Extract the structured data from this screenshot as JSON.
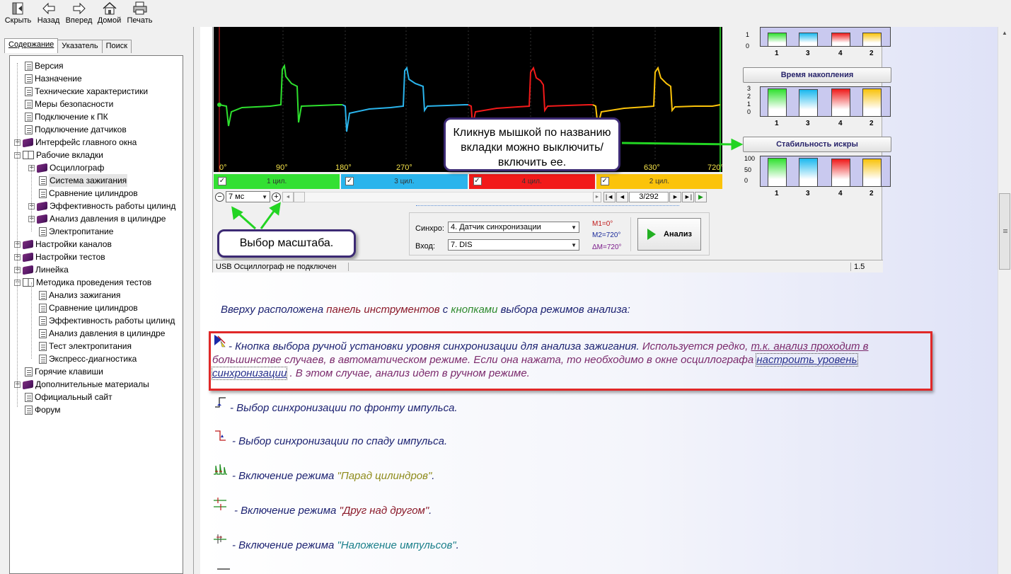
{
  "toolbar": {
    "buttons": [
      {
        "label": "Скрыть",
        "icon": "hide-icon"
      },
      {
        "label": "Назад",
        "icon": "back-arrow-icon"
      },
      {
        "label": "Вперед",
        "icon": "forward-arrow-icon"
      },
      {
        "label": "Домой",
        "icon": "home-icon"
      },
      {
        "label": "Печать",
        "icon": "printer-icon"
      }
    ]
  },
  "nav_tabs": [
    {
      "label": "Содержание",
      "active": true
    },
    {
      "label": "Указатель",
      "active": false
    },
    {
      "label": "Поиск",
      "active": false
    }
  ],
  "tree": [
    {
      "label": "Версия",
      "level": 0,
      "icon": "page",
      "expander": ""
    },
    {
      "label": "Назначение",
      "level": 0,
      "icon": "page",
      "expander": ""
    },
    {
      "label": "Технические характеристики",
      "level": 0,
      "icon": "page",
      "expander": ""
    },
    {
      "label": "Меры безопасности",
      "level": 0,
      "icon": "page",
      "expander": ""
    },
    {
      "label": "Подключение к ПК",
      "level": 0,
      "icon": "page",
      "expander": ""
    },
    {
      "label": "Подключение датчиков",
      "level": 0,
      "icon": "page",
      "expander": ""
    },
    {
      "label": "Интерфейс главного окна",
      "level": 0,
      "icon": "book",
      "expander": "+"
    },
    {
      "label": "Рабочие вкладки",
      "level": 0,
      "icon": "open",
      "expander": "-"
    },
    {
      "label": "Осциллограф",
      "level": 1,
      "icon": "book",
      "expander": "+"
    },
    {
      "label": "Система зажигания",
      "level": 1,
      "icon": "page",
      "expander": "",
      "selected": true
    },
    {
      "label": "Сравнение цилиндров",
      "level": 1,
      "icon": "page",
      "expander": ""
    },
    {
      "label": "Эффективность работы цилинд",
      "level": 1,
      "icon": "book",
      "expander": "+"
    },
    {
      "label": "Анализ давления в цилиндре",
      "level": 1,
      "icon": "book",
      "expander": "+"
    },
    {
      "label": "Электропитание",
      "level": 1,
      "icon": "page",
      "expander": ""
    },
    {
      "label": "Настройки каналов",
      "level": 0,
      "icon": "book",
      "expander": "+"
    },
    {
      "label": "Настройки тестов",
      "level": 0,
      "icon": "book",
      "expander": "+"
    },
    {
      "label": "Линейка",
      "level": 0,
      "icon": "book",
      "expander": "+"
    },
    {
      "label": "Методика проведения тестов",
      "level": 0,
      "icon": "open",
      "expander": "-"
    },
    {
      "label": "Анализ зажигания",
      "level": 1,
      "icon": "page",
      "expander": ""
    },
    {
      "label": "Сравнение цилиндров",
      "level": 1,
      "icon": "page",
      "expander": ""
    },
    {
      "label": "Эффективность работы цилинд",
      "level": 1,
      "icon": "page",
      "expander": ""
    },
    {
      "label": "Анализ давления в цилиндре",
      "level": 1,
      "icon": "page",
      "expander": ""
    },
    {
      "label": "Тест электропитания",
      "level": 1,
      "icon": "page",
      "expander": ""
    },
    {
      "label": "Экспресс-диагностика",
      "level": 1,
      "icon": "page",
      "expander": ""
    },
    {
      "label": "Горячие клавиши",
      "level": 0,
      "icon": "page",
      "expander": ""
    },
    {
      "label": "Дополнительные материалы",
      "level": 0,
      "icon": "book",
      "expander": "+"
    },
    {
      "label": "Официальный сайт",
      "level": 0,
      "icon": "page",
      "expander": ""
    },
    {
      "label": "Форум",
      "level": 0,
      "icon": "page",
      "expander": ""
    }
  ],
  "osc_panel": {
    "ticks": [
      "0°",
      "90°",
      "180°",
      "270°",
      "630°",
      "720°"
    ],
    "channel_tabs": [
      {
        "label": "1 цил.",
        "color": "#33e033"
      },
      {
        "label": "3 цил.",
        "color": "#2ab4ec"
      },
      {
        "label": "4 цил.",
        "color": "#f21a1a"
      },
      {
        "label": "2 цил.",
        "color": "#fbc30a"
      }
    ],
    "zoom_value": "7 мс",
    "page_counter": "3/292",
    "sync_label": "Синхро:",
    "sync_value": "4.  Датчик синхронизации",
    "input_label": "Вход:",
    "input_value": "7.  DIS",
    "markers": {
      "m1": "M1=0°",
      "m2": "M2=720°",
      "dm": "ΔM=720°"
    },
    "analyze_label": "Анализ",
    "status_text": "USB Осциллограф не подключен",
    "status_version": "1.5"
  },
  "meters": [
    {
      "title": "",
      "y_ticks": [
        "1",
        "0"
      ],
      "labels": [
        "1",
        "3",
        "4",
        "2"
      ],
      "values": [
        1,
        1,
        1,
        1
      ]
    },
    {
      "title": "Время накопления",
      "y_ticks": [
        "3",
        "2",
        "1",
        "0"
      ],
      "labels": [
        "1",
        "3",
        "4",
        "2"
      ],
      "values": [
        3.1,
        3.0,
        3.1,
        3.1
      ]
    },
    {
      "title": "Стабильность искры",
      "y_ticks": [
        "100",
        "50",
        "0"
      ],
      "labels": [
        "1",
        "3",
        "4",
        "2"
      ],
      "values": [
        95,
        95,
        93,
        93
      ]
    }
  ],
  "callouts": {
    "tab_toggle": "Кликнув мышкой по названию вкладки можно выключить/включить ее.",
    "scale": "Выбор масштаба."
  },
  "text": {
    "intro_a": "Вверху расположена ",
    "intro_b": "панель инструментов",
    "intro_c": " с ",
    "intro_d": "кнопками",
    "intro_e": " выбора режимов анализа:",
    "manual_a": " - Кнопка выбора ручной установки уровня синхронизации для анализа зажигания. ",
    "manual_b": "Используется редко, ",
    "manual_c": "т.к. анализ проходит в",
    "manual_d": "большинстве случаев, в автоматическом режиме. Если она нажата, то необходимо в окне осциллографа ",
    "manual_link1": "настроить уровень",
    "manual_link2": "синхронизации",
    "manual_e": " . В этом случае, анализ идет в ручном режиме.",
    "front": " - Выбор синхронизации по фронту импульса.",
    "fall": " - Выбор синхронизации по спаду импульса.",
    "parade_a": " - Включение режима ",
    "parade_b": "\"Парад цилиндров\"",
    "parade_c": ".",
    "stack_a": " - Включение режима ",
    "stack_b": "\"Друг над другом\"",
    "stack_c": ".",
    "overlay_a": " - Включение режима ",
    "overlay_b": "\"Наложение импульсов\"",
    "overlay_c": "."
  },
  "colors": {
    "red_frame": "#e02828",
    "callout_border": "#3c2a74",
    "arrow_green": "#22d422"
  }
}
